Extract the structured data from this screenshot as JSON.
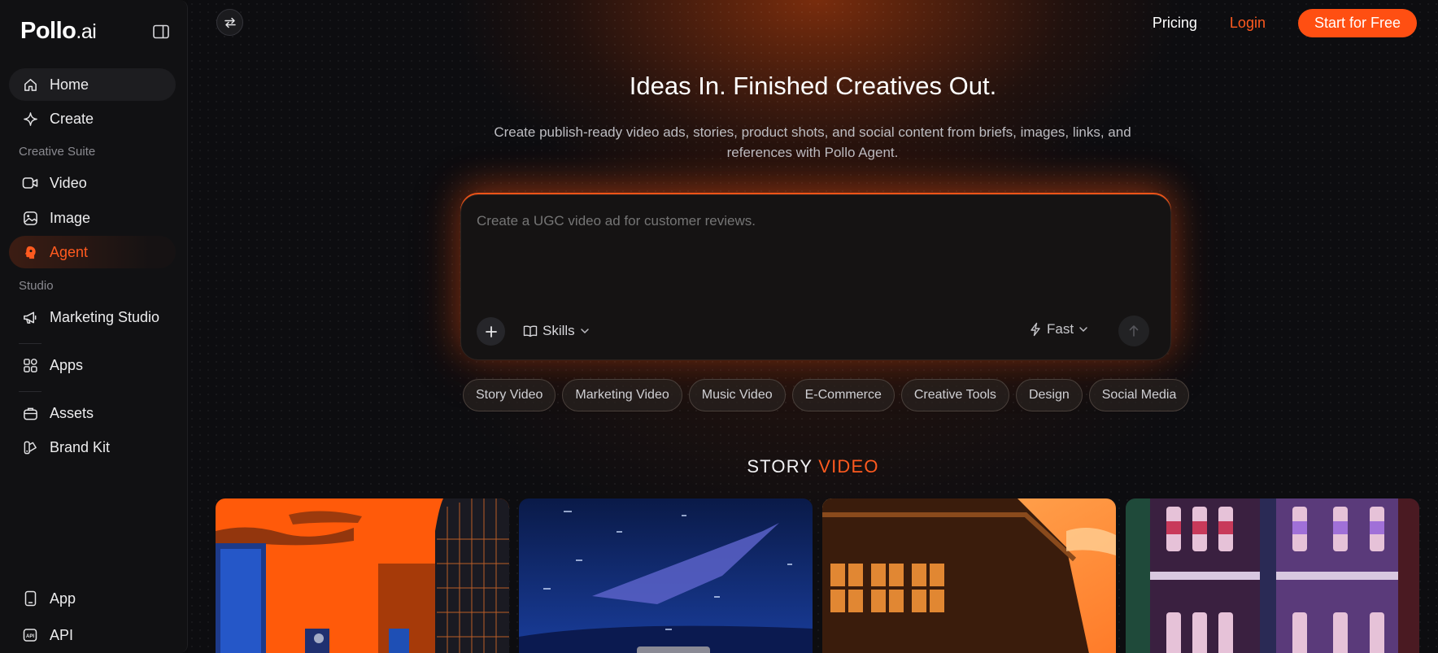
{
  "sidebar": {
    "logo_main": "Pollo",
    "logo_suffix": ".ai",
    "items": {
      "home": "Home",
      "create": "Create",
      "video": "Video",
      "image": "Image",
      "agent": "Agent",
      "marketing_studio": "Marketing Studio",
      "apps": "Apps",
      "assets": "Assets",
      "brand_kit": "Brand Kit",
      "app": "App",
      "api": "API"
    },
    "sections": {
      "creative_suite": "Creative Suite",
      "studio": "Studio"
    },
    "accent_color": "#ff5a1f"
  },
  "header": {
    "pricing": "Pricing",
    "login": "Login",
    "start_button": "Start for Free"
  },
  "hero": {
    "title": "Ideas In. Finished Creatives Out.",
    "subtitle": "Create publish-ready video ads, stories, product shots, and social content from briefs, images, links, and references with Pollo Agent."
  },
  "prompt": {
    "placeholder": "Create a UGC video ad for customer reviews.",
    "skills_label": "Skills",
    "mode_label": "Fast"
  },
  "chips": [
    "Story Video",
    "Marketing Video",
    "Music Video",
    "E-Commerce",
    "Creative Tools",
    "Design",
    "Social Media"
  ],
  "section": {
    "title_part1": "STORY ",
    "title_part2": "VIDEO"
  },
  "icons": {
    "collapse": "sidebar-toggle-icon",
    "swap": "swap-arrows-icon",
    "home": "home-icon",
    "create": "sparkle-icon",
    "video": "video-camera-icon",
    "image": "image-icon",
    "agent": "agent-head-icon",
    "marketing": "megaphone-icon",
    "apps": "apps-grid-icon",
    "assets": "briefcase-icon",
    "brand_kit": "brand-kit-icon",
    "app": "phone-icon",
    "api": "api-icon"
  }
}
